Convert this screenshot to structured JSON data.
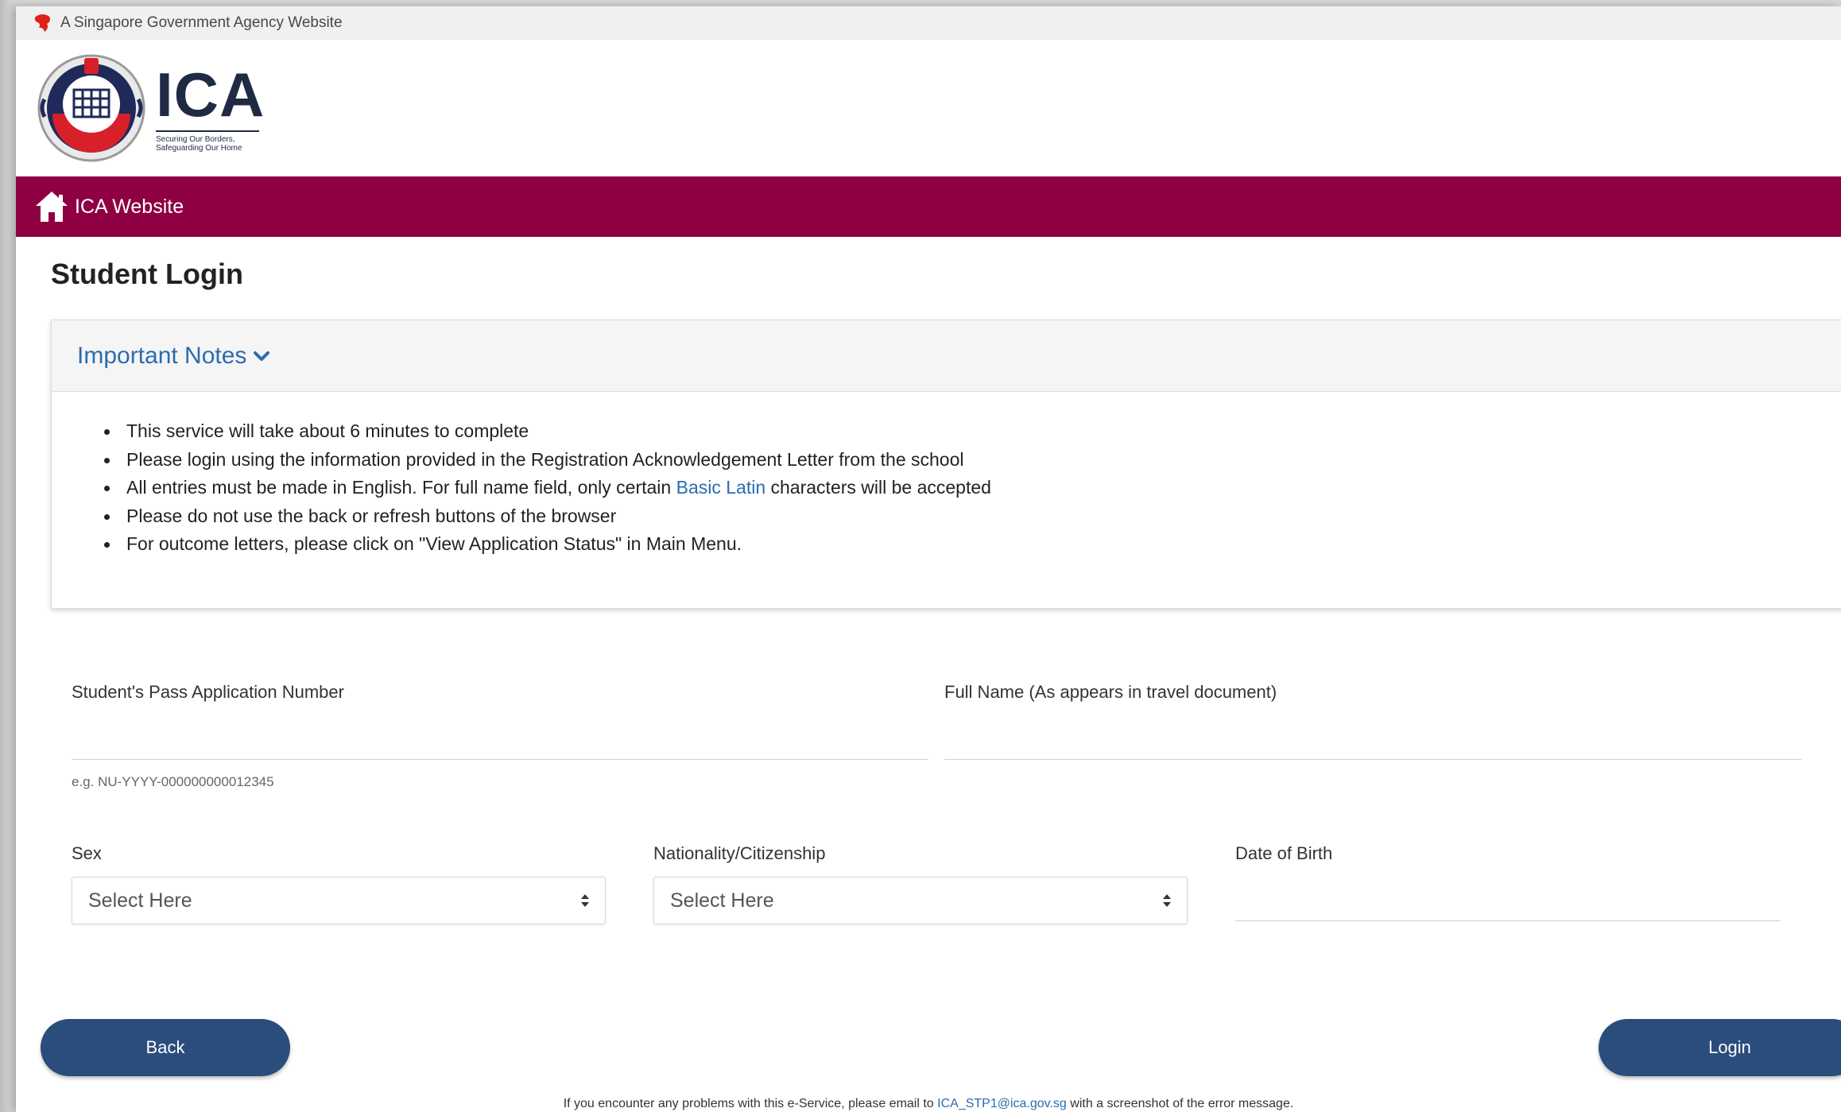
{
  "gov_bar": {
    "text": "A Singapore Government Agency Website"
  },
  "logo": {
    "word": "ICA",
    "tagline_line1": "Securing Our Borders,",
    "tagline_line2": "Safeguarding Our Home"
  },
  "nav": {
    "home_label": "ICA Website"
  },
  "page": {
    "title": "Student Login"
  },
  "notes": {
    "title": "Important Notes",
    "items": [
      "This service will take about 6 minutes to complete",
      "Please login using the information provided in the Registration Acknowledgement Letter from the school",
      {
        "before": "All entries must be made in English. For full name field, only certain ",
        "link": "Basic Latin",
        "after": " characters will be accepted"
      },
      "Please do not use the back or refresh buttons of the browser",
      "For outcome letters, please click on \"View Application Status\" in Main Menu."
    ]
  },
  "form": {
    "app_number": {
      "label": "Student's Pass Application Number",
      "value": "",
      "hint": "e.g. NU-YYYY-000000000012345"
    },
    "full_name": {
      "label": "Full Name (As appears in travel document)",
      "value": ""
    },
    "sex": {
      "label": "Sex",
      "selected": "Select Here"
    },
    "nationality": {
      "label": "Nationality/Citizenship",
      "selected": "Select Here"
    },
    "dob": {
      "label": "Date of Birth",
      "value": ""
    }
  },
  "buttons": {
    "back": "Back",
    "login": "Login"
  },
  "footer": {
    "before": "If you encounter any problems with this e-Service, please email to ",
    "email": "ICA_STP1@ica.gov.sg",
    "after": " with a screenshot of the error message."
  },
  "colors": {
    "nav_bg": "#8e0041",
    "button_bg": "#2a4d7c",
    "link": "#2b6cb0"
  }
}
